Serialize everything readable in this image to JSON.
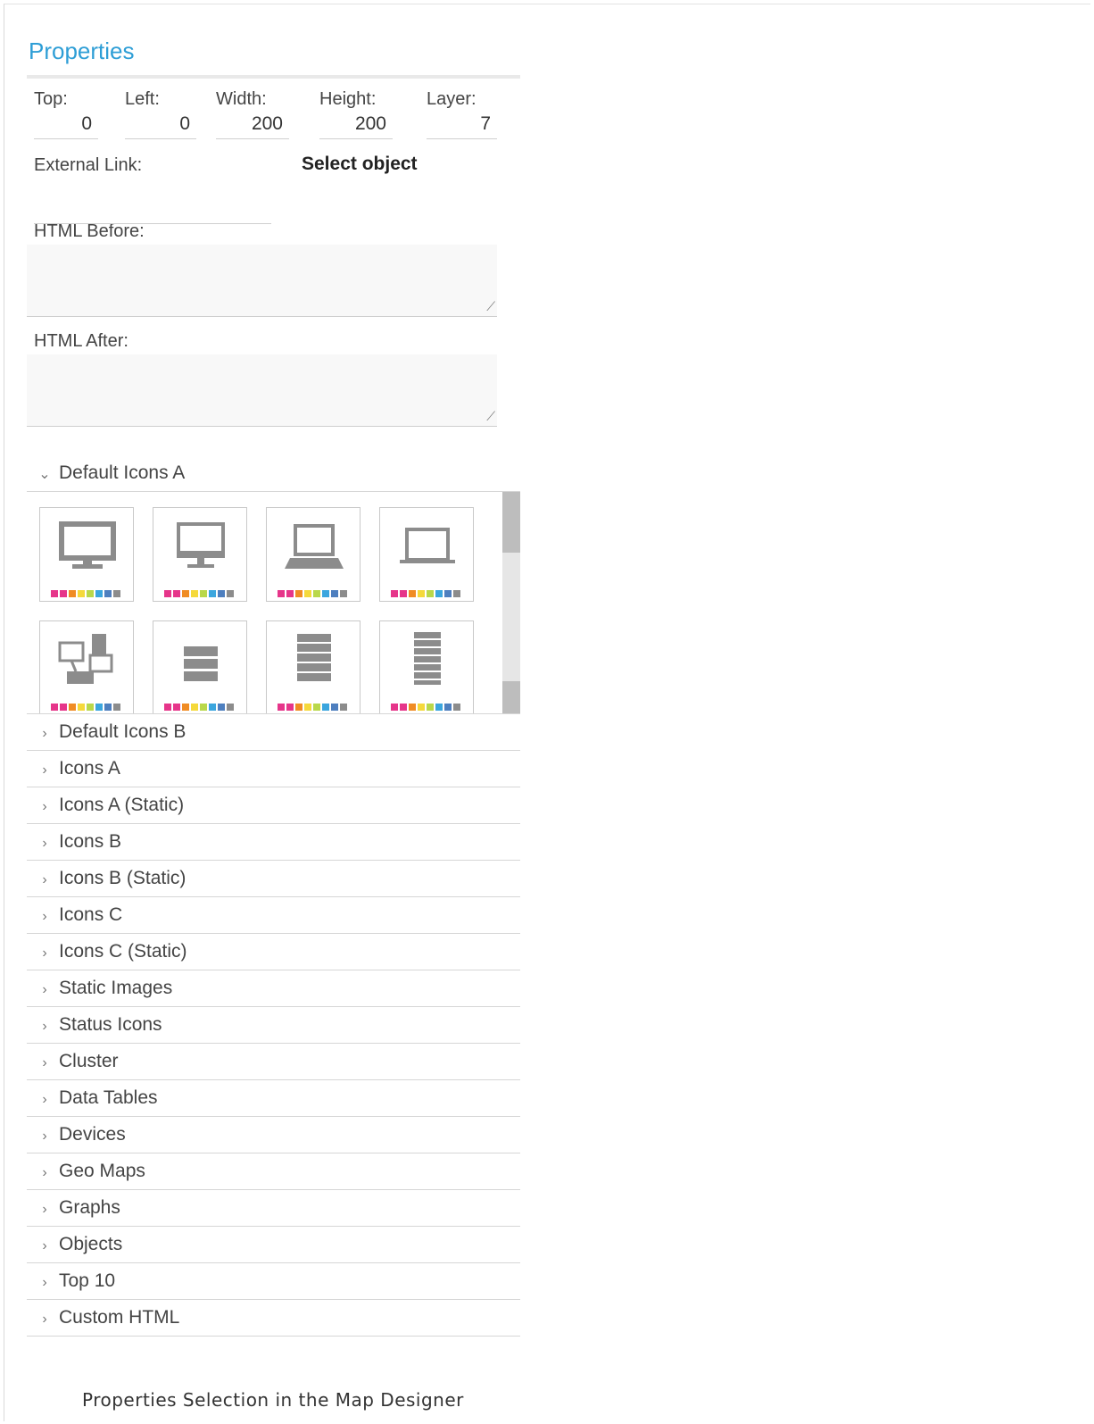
{
  "panel": {
    "title": "Properties",
    "fields": [
      {
        "label": "Top:",
        "value": "0"
      },
      {
        "label": "Left:",
        "value": "0"
      },
      {
        "label": "Width:",
        "value": "200"
      },
      {
        "label": "Height:",
        "value": "200"
      },
      {
        "label": "Layer:",
        "value": "7"
      }
    ],
    "external_link_label": "External Link:",
    "select_object": "Select object",
    "html_before_label": "HTML Before:",
    "html_after_label": "HTML After:",
    "open_section": "Default Icons A",
    "icon_tiles": [
      "monitor-icon",
      "desktop-icon",
      "laptop-icon",
      "notebook-icon",
      "network-icon",
      "server-small-icon",
      "server-medium-icon",
      "server-large-icon"
    ],
    "status_colors": [
      "#e6358a",
      "#e6358a",
      "#f08c24",
      "#f5d93b",
      "#b9d84a",
      "#3ba6de",
      "#4e7fbf",
      "#8c8c8c"
    ],
    "sections": [
      "Default Icons B",
      "Icons A",
      "Icons A (Static)",
      "Icons B",
      "Icons B (Static)",
      "Icons C",
      "Icons C (Static)",
      "Static Images",
      "Status Icons",
      "Cluster",
      "Data Tables",
      "Devices",
      "Geo Maps",
      "Graphs",
      "Objects",
      "Top 10",
      "Custom HTML"
    ]
  },
  "caption": "Properties Selection in the Map Designer"
}
